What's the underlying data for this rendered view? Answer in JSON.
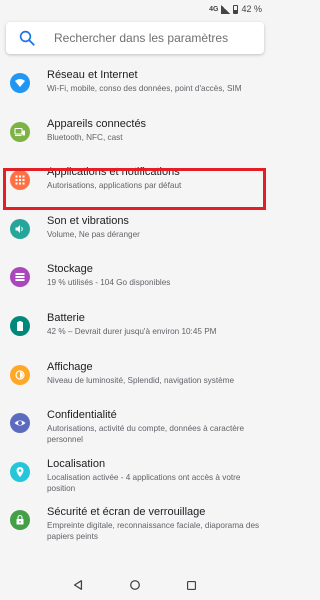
{
  "status_bar": {
    "network": "4G",
    "battery": "42 %"
  },
  "search": {
    "placeholder": "Rechercher dans les paramètres"
  },
  "items": [
    {
      "title": "Réseau et Internet",
      "subtitle": "Wi-Fi, mobile, conso des données, point d'accès, SIM",
      "icon": "wifi-icon",
      "color": "#2196f3"
    },
    {
      "title": "Appareils connectés",
      "subtitle": "Bluetooth, NFC, cast",
      "icon": "devices-icon",
      "color": "#7cb342"
    },
    {
      "title": "Applications et notifications",
      "subtitle": "Autorisations, applications par défaut",
      "icon": "apps-icon",
      "color": "#ff7043"
    },
    {
      "title": "Son et vibrations",
      "subtitle": "Volume, Ne pas déranger",
      "icon": "volume-icon",
      "color": "#26a69a"
    },
    {
      "title": "Stockage",
      "subtitle": "19 % utilisés - 104 Go disponibles",
      "icon": "storage-icon",
      "color": "#ab47bc"
    },
    {
      "title": "Batterie",
      "subtitle": "42 % – Devrait durer jusqu'à environ 10:45 PM",
      "icon": "battery-icon",
      "color": "#00897b"
    },
    {
      "title": "Affichage",
      "subtitle": "Niveau de luminosité, Splendid, navigation système",
      "icon": "brightness-icon",
      "color": "#ffa726"
    },
    {
      "title": "Confidentialité",
      "subtitle": "Autorisations, activité du compte, données à caractère personnel",
      "icon": "eye-icon",
      "color": "#5c6bc0"
    },
    {
      "title": "Localisation",
      "subtitle": "Localisation activée - 4 applications ont accès à votre position",
      "icon": "location-icon",
      "color": "#26c6da"
    },
    {
      "title": "Sécurité et écran de verrouillage",
      "subtitle": "Empreinte digitale, reconnaissance faciale, diaporama des papiers peints",
      "icon": "lock-icon",
      "color": "#43a047"
    }
  ]
}
